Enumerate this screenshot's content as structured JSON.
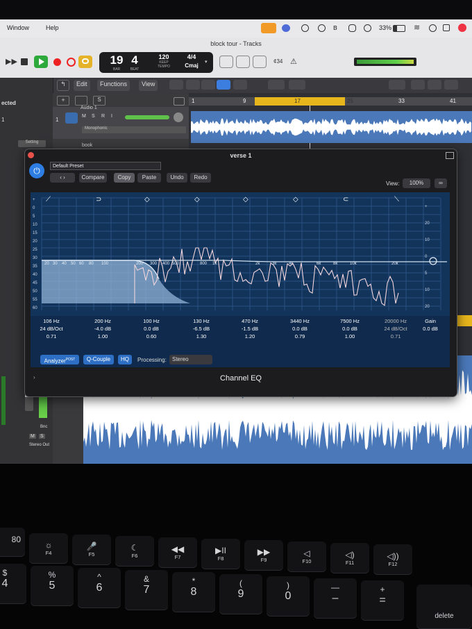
{
  "menubar": {
    "items": [
      "Window",
      "Help"
    ],
    "battery": "33%"
  },
  "window_title": "block tour - Tracks",
  "lcd": {
    "bar": "19",
    "beat": "4",
    "bar_label": "BAR",
    "beat_label": "BEAT",
    "tempo": "120",
    "tempo_sub": "KEEP",
    "tempo_label": "TEMPO",
    "signature": "4/4",
    "key": "Cmaj"
  },
  "control_right": {
    "counter": "¢34"
  },
  "toolbar": {
    "edit": "Edit",
    "functions": "Functions",
    "view": "View"
  },
  "inspector": {
    "label": "ected",
    "num": "1",
    "setting": "Setting"
  },
  "track": {
    "number": "1",
    "name": "Audio 1",
    "buttons": [
      "M",
      "S",
      "R",
      "I"
    ],
    "mode": "Monophonic",
    "next_name": "book"
  },
  "ruler": {
    "bars": [
      "1",
      "9",
      "17",
      "25",
      "33",
      "41"
    ]
  },
  "plugin": {
    "title": "verse 1",
    "preset": "Default Preset",
    "compare": "Compare",
    "copy": "Copy",
    "paste": "Paste",
    "undo": "Undo",
    "redo": "Redo",
    "view_label": "View:",
    "view_value": "100%",
    "footer": "Channel EQ",
    "analyzer": "Analyzer",
    "analyzer_sup": "POST",
    "qcouple": "Q-Couple",
    "hq": "HQ",
    "processing_label": "Processing:",
    "processing_value": "Stereo",
    "db_left": [
      "+",
      "0",
      "5",
      "10",
      "15",
      "20",
      "25",
      "30",
      "35",
      "40",
      "45",
      "50",
      "55",
      "60"
    ],
    "db_right": [
      "+",
      "20",
      "10",
      "0",
      "5",
      "10",
      "20"
    ],
    "freq_labels": [
      "20",
      "30",
      "40",
      "50",
      "60",
      "80",
      "100",
      "200",
      "300",
      "400",
      "500",
      "800",
      "1k",
      "2k",
      "3k",
      "4k",
      "6k",
      "8k",
      "10k",
      "20k"
    ],
    "bands": [
      {
        "freq": "106 Hz",
        "gain": "24 dB/Oct",
        "q": "0.71"
      },
      {
        "freq": "200 Hz",
        "gain": "-4.0 dB",
        "q": "1.00"
      },
      {
        "freq": "100 Hz",
        "gain": "0.0 dB",
        "q": "0.60"
      },
      {
        "freq": "130 Hz",
        "gain": "-6.5 dB",
        "q": "1.30"
      },
      {
        "freq": "470 Hz",
        "gain": "-1.5 dB",
        "q": "1.20"
      },
      {
        "freq": "3440 Hz",
        "gain": "0.0 dB",
        "q": "0.79"
      },
      {
        "freq": "7500 Hz",
        "gain": "0.0 dB",
        "q": "1.00"
      },
      {
        "freq": "20000 Hz",
        "gain": "24 dB/Oct",
        "q": "0.71"
      }
    ],
    "gain_label": "Gain",
    "gain_value": "0.0 dB"
  },
  "mixer": {
    "bnc": "Bnc",
    "stereo_out": "Stereo Out",
    "m": "M",
    "s": "S",
    "i": "I"
  },
  "dock": {
    "badge": "1"
  },
  "keyboard": {
    "fn_keys": [
      {
        "icon": "☼",
        "label": "F4"
      },
      {
        "icon": "🎤",
        "label": "F5"
      },
      {
        "icon": "☾",
        "label": "F6"
      },
      {
        "icon": "◀◀",
        "label": "F7"
      },
      {
        "icon": "▶II",
        "label": "F8"
      },
      {
        "icon": "▶▶",
        "label": "F9"
      },
      {
        "icon": "◁",
        "label": "F10"
      },
      {
        "icon": "◁)",
        "label": "F11"
      },
      {
        "icon": "◁))",
        "label": "F12"
      }
    ],
    "num_keys": [
      {
        "up": "$",
        "dn": "4"
      },
      {
        "up": "%",
        "dn": "5"
      },
      {
        "up": "^",
        "dn": "6"
      },
      {
        "up": "&",
        "dn": "7"
      },
      {
        "up": "*",
        "dn": "8"
      },
      {
        "up": "(",
        "dn": "9"
      },
      {
        "up": ")",
        "dn": "0"
      },
      {
        "up": "—",
        "dn": "–"
      },
      {
        "up": "+",
        "dn": "="
      }
    ],
    "f3_label": "80",
    "delete": "delete"
  }
}
